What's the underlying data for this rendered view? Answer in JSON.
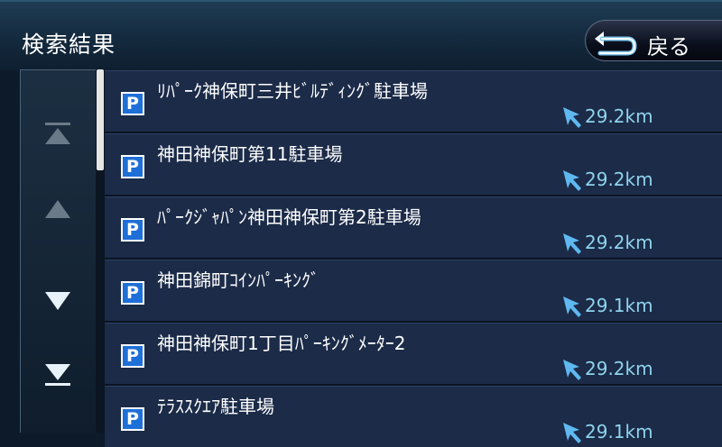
{
  "header": {
    "title": "検索結果",
    "back_label": "戻る"
  },
  "scroll": {
    "buttons": [
      "scroll-top",
      "scroll-up",
      "scroll-down",
      "scroll-bottom"
    ],
    "up_color": "#6a7a88",
    "down_color": "#e8f2fa"
  },
  "results": [
    {
      "name": "ﾘﾊﾟｰｸ神保町三井ﾋﾞﾙﾃﾞｨﾝｸﾞ駐車場",
      "distance": "29.2km",
      "icon": "parking-icon"
    },
    {
      "name": "神田神保町第11駐車場",
      "distance": "29.2km",
      "icon": "parking-icon"
    },
    {
      "name": "ﾊﾟｰｸｼﾞｬﾊﾟﾝ神田神保町第2駐車場",
      "distance": "29.2km",
      "icon": "parking-icon"
    },
    {
      "name": "神田錦町ｺｲﾝﾊﾟｰｷﾝｸﾞ",
      "distance": "29.1km",
      "icon": "parking-icon"
    },
    {
      "name": "神田神保町1丁目ﾊﾟｰｷﾝｸﾞﾒｰﾀｰ2",
      "distance": "29.2km",
      "icon": "parking-icon"
    },
    {
      "name": "ﾃﾗｽｽｸｴｱ駐車場",
      "distance": "29.1km",
      "icon": "parking-icon"
    }
  ],
  "colors": {
    "row_bg": "#1b2b48",
    "distance_text": "#8fd3ec",
    "parking_blue": "#1e6fd8"
  }
}
